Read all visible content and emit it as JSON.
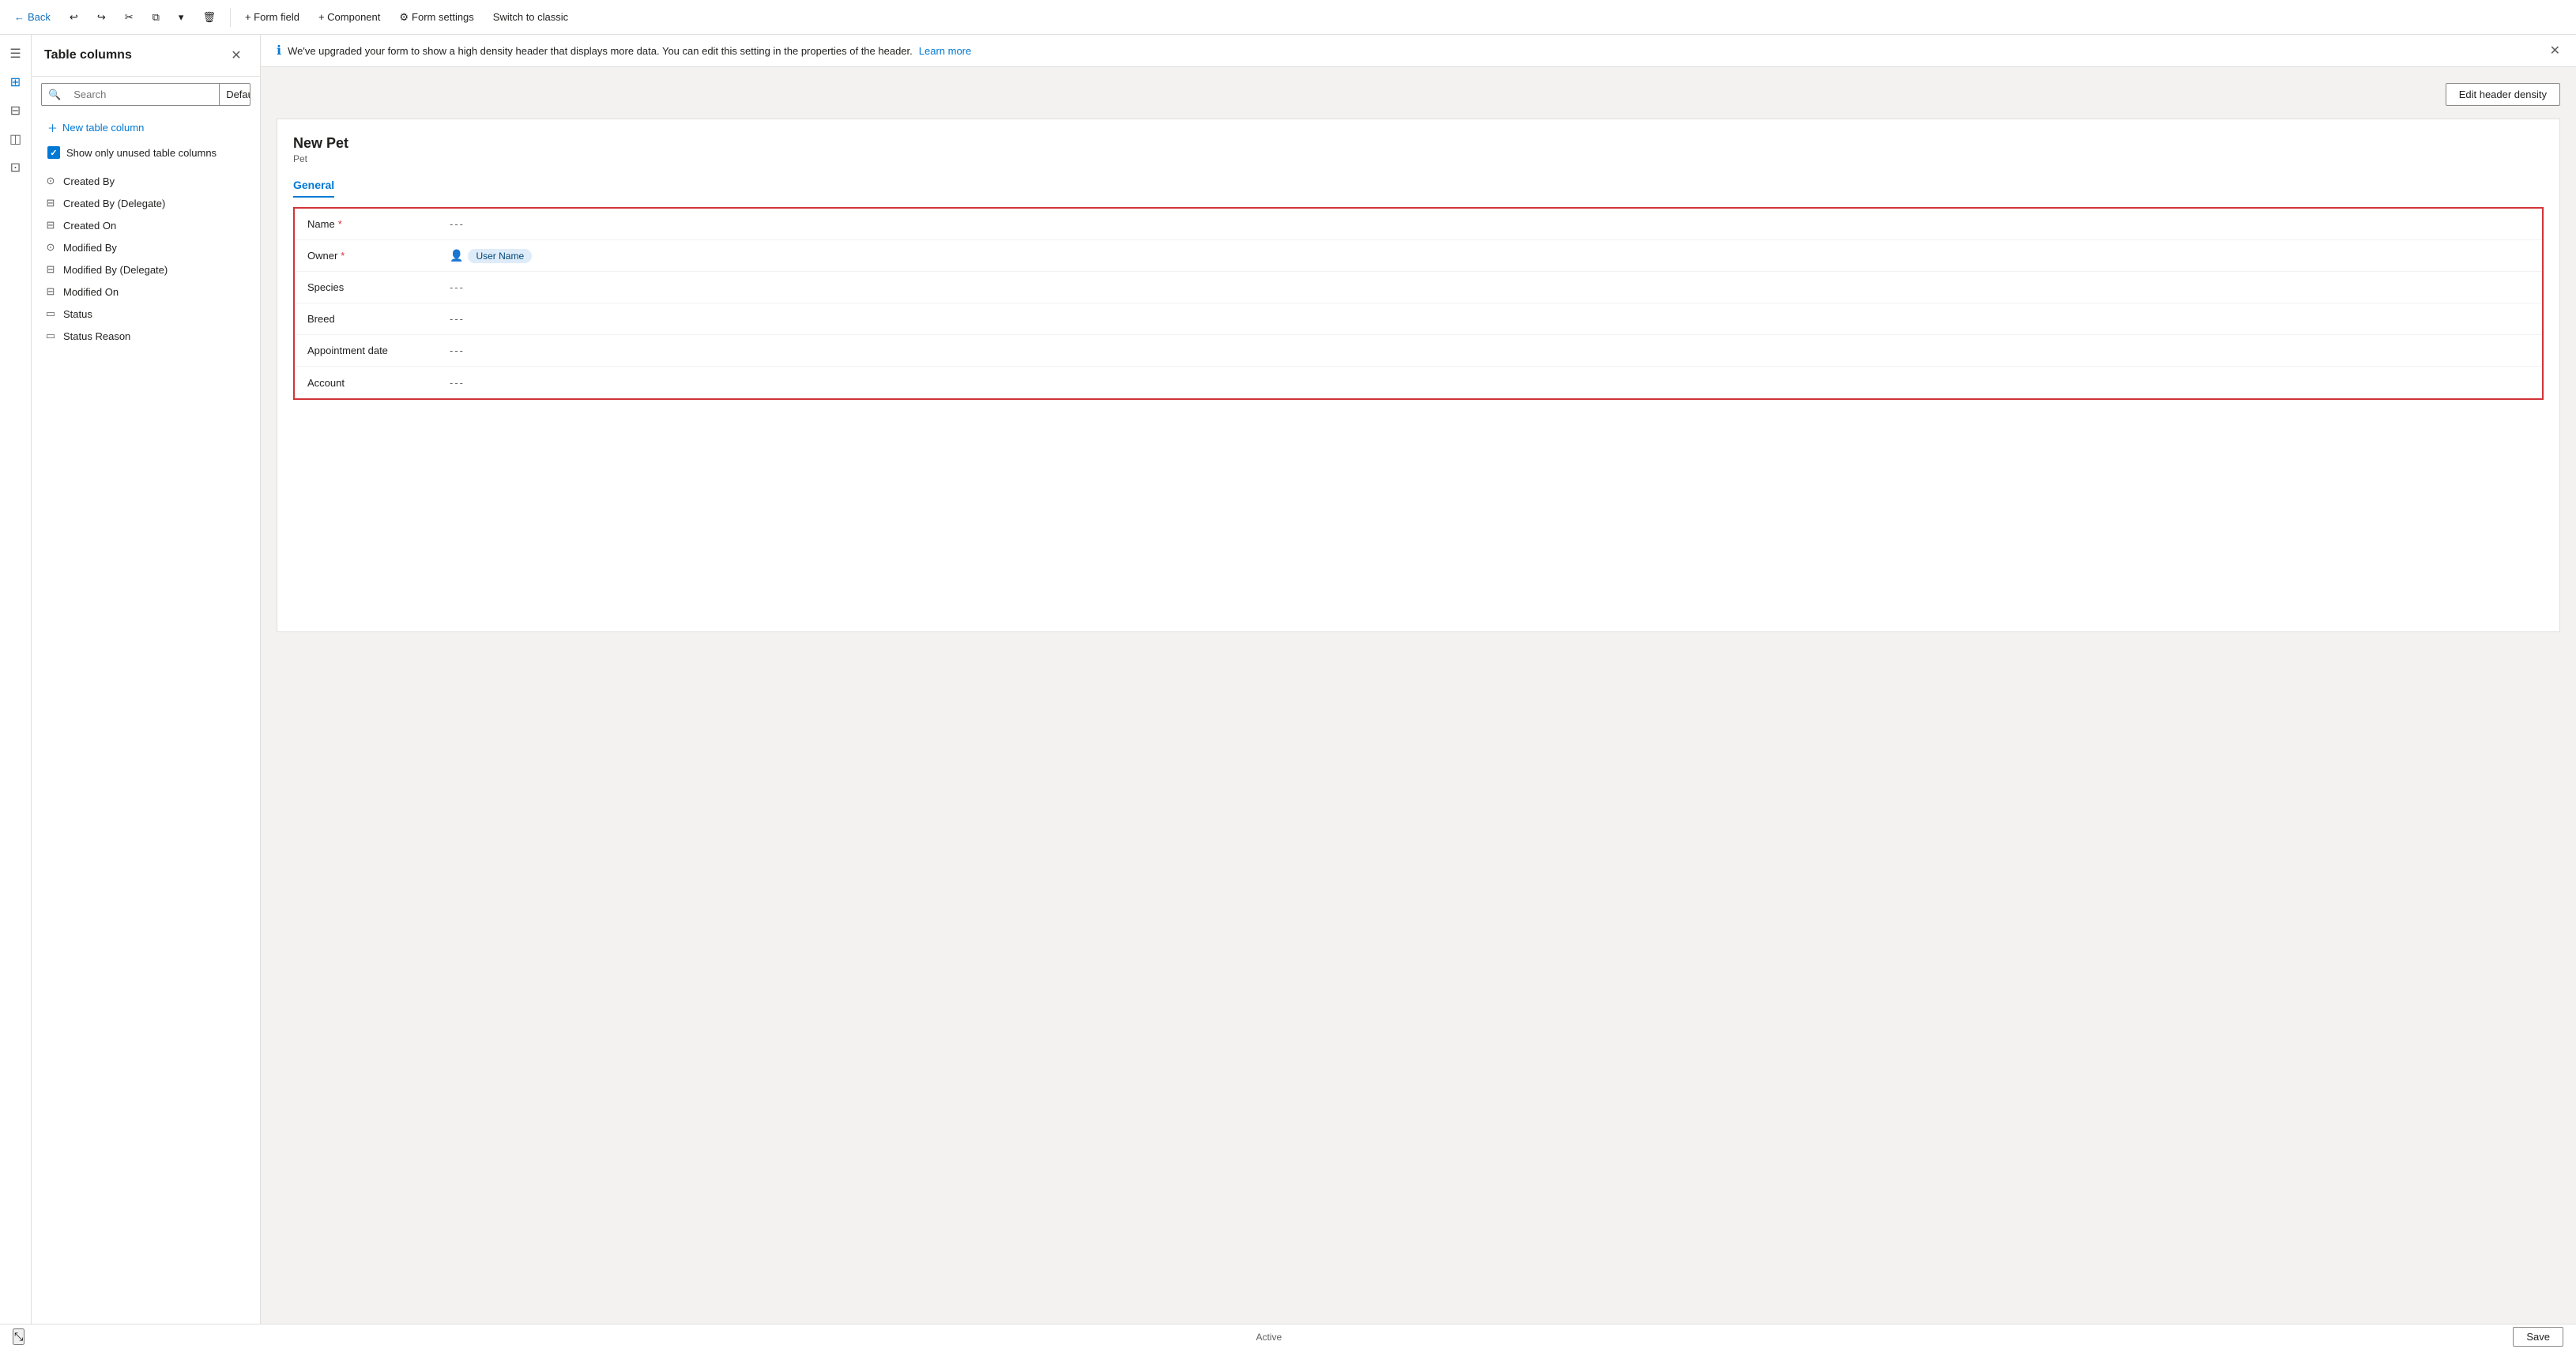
{
  "toolbar": {
    "back_label": "Back",
    "undo_icon": "↩",
    "redo_icon": "↪",
    "cut_icon": "✂",
    "copy_icon": "⧉",
    "more_icon": "▾",
    "delete_icon": "🗑",
    "form_field_label": "+ Form field",
    "component_label": "+ Component",
    "form_settings_label": "Form settings",
    "switch_classic_label": "Switch to classic"
  },
  "sidebar": {
    "icons": [
      {
        "name": "hamburger",
        "icon": "☰"
      },
      {
        "name": "views",
        "icon": "⊞"
      },
      {
        "name": "table",
        "icon": "⊟"
      },
      {
        "name": "layers",
        "icon": "◫"
      },
      {
        "name": "data",
        "icon": "⊡"
      }
    ]
  },
  "panel": {
    "title": "Table columns",
    "search_placeholder": "Search",
    "dropdown_label": "Default",
    "new_column_label": "New table column",
    "unused_checkbox_label": "Show only unused table columns",
    "columns": [
      {
        "name": "Created By",
        "icon": "circle-info"
      },
      {
        "name": "Created By (Delegate)",
        "icon": "table"
      },
      {
        "name": "Created On",
        "icon": "table"
      },
      {
        "name": "Modified By",
        "icon": "circle-info"
      },
      {
        "name": "Modified By (Delegate)",
        "icon": "table"
      },
      {
        "name": "Modified On",
        "icon": "table"
      },
      {
        "name": "Status",
        "icon": "rectangle"
      },
      {
        "name": "Status Reason",
        "icon": "rectangle"
      }
    ]
  },
  "info_bar": {
    "text": "We've upgraded your form to show a high density header that displays more data. You can edit this setting in the properties of the header.",
    "link_text": "Learn more"
  },
  "edit_header_density": {
    "label": "Edit header density"
  },
  "form": {
    "title": "New Pet",
    "subtitle": "Pet",
    "tab_label": "General",
    "fields": [
      {
        "label": "Name",
        "required": true,
        "value": "---",
        "type": "text"
      },
      {
        "label": "Owner",
        "required": true,
        "value": "",
        "type": "user",
        "user_chip": "User Name"
      },
      {
        "label": "Species",
        "required": false,
        "value": "---",
        "type": "text"
      },
      {
        "label": "Breed",
        "required": false,
        "value": "---",
        "type": "text"
      },
      {
        "label": "Appointment date",
        "required": false,
        "value": "---",
        "type": "text"
      },
      {
        "label": "Account",
        "required": false,
        "value": "---",
        "type": "text"
      }
    ]
  },
  "status_bar": {
    "active_label": "Active",
    "save_label": "Save"
  }
}
